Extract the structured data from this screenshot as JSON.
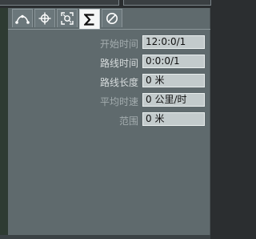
{
  "tabs": [
    {
      "name": "curve",
      "icon": "curve-points-icon",
      "active": false
    },
    {
      "name": "move",
      "icon": "crosshair-move-icon",
      "active": false
    },
    {
      "name": "transform",
      "icon": "corner-target-icon",
      "active": false
    },
    {
      "name": "statistics",
      "icon": "sigma-icon",
      "active": true
    },
    {
      "name": "cancel",
      "icon": "no-entry-icon",
      "active": false
    }
  ],
  "stats": {
    "start_time_label": "开始时间",
    "start_time_value": "12:0:0/1",
    "route_time_label": "路线时间",
    "route_time_value": "0:0:0/1",
    "route_length_label": "路线长度",
    "route_length_value": "0 米",
    "avg_speed_label": "平均时速",
    "avg_speed_value": "0 公里/时",
    "range_label": "范围",
    "range_value": "0 米"
  },
  "colors": {
    "panel": "#5f6a6d",
    "field": "#c3cbcc",
    "label": "#d7dcdd",
    "active_tab": "#f4f6f6"
  }
}
